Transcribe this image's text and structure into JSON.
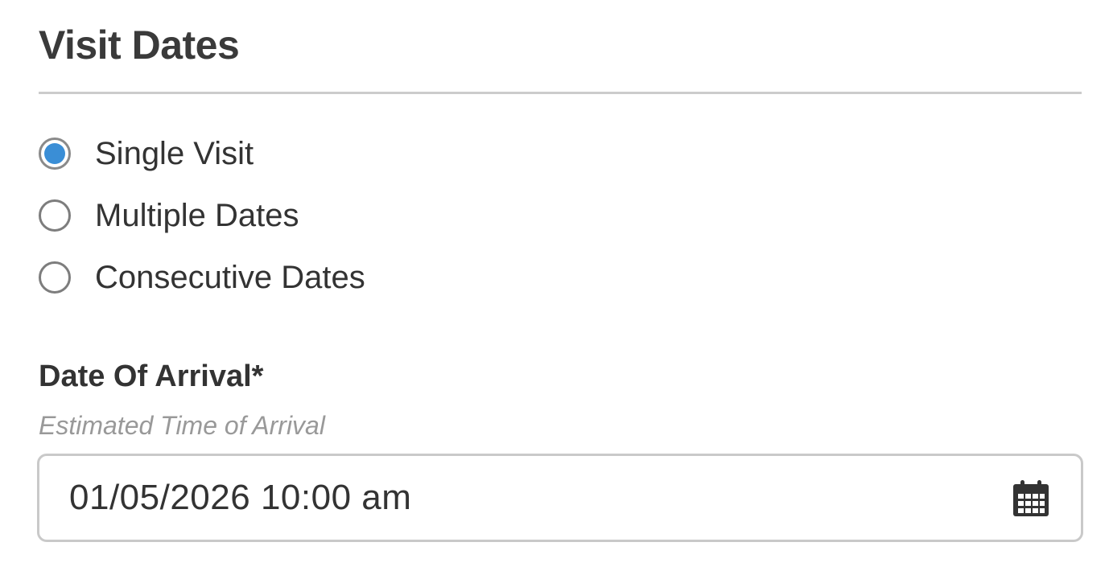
{
  "section": {
    "title": "Visit Dates"
  },
  "visit_type": {
    "options": [
      {
        "label": "Single Visit",
        "selected": true
      },
      {
        "label": "Multiple Dates",
        "selected": false
      },
      {
        "label": "Consecutive Dates",
        "selected": false
      }
    ]
  },
  "arrival": {
    "label": "Date Of Arrival*",
    "hint": "Estimated Time of Arrival",
    "value": "01/05/2026 10:00 am",
    "icon": "calendar-icon"
  },
  "colors": {
    "accent": "#3a8ed6",
    "text": "#333333",
    "hint": "#999999",
    "border": "#c9c9c9"
  }
}
